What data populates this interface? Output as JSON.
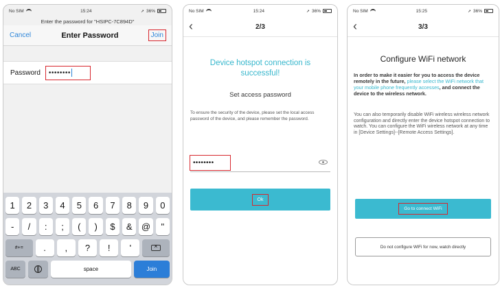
{
  "screens": [
    {
      "status": {
        "carrier": "No SIM",
        "time": "15:24",
        "battery": "36%"
      },
      "subtitle": "Enter the password for \"HSIPC-7C894D\"",
      "nav": {
        "cancel": "Cancel",
        "title": "Enter Password",
        "join": "Join"
      },
      "password_label": "Password",
      "password_value": "••••••••",
      "keyboard": {
        "row1": [
          "1",
          "2",
          "3",
          "4",
          "5",
          "6",
          "7",
          "8",
          "9",
          "0"
        ],
        "row2": [
          "-",
          "/",
          ":",
          ";",
          "(",
          ")",
          "$",
          "&",
          "@",
          "\""
        ],
        "row3_left": "#+=",
        "row3": [
          ".",
          ",",
          "?",
          "!",
          "'"
        ],
        "abc": "ABC",
        "space": "space",
        "join": "Join"
      }
    },
    {
      "status": {
        "carrier": "No SIM",
        "time": "15:24",
        "battery": "36%"
      },
      "step": "2/3",
      "success": "Device hotspot connection is successful!",
      "set_title": "Set access password",
      "desc": "To ensure the security of the device, please set the local access password of the device, and please remember the password.",
      "password_value": "••••••••",
      "ok": "Ok"
    },
    {
      "status": {
        "carrier": "No SIM",
        "time": "15:25",
        "battery": "36%"
      },
      "step": "3/3",
      "title": "Configure WiFi network",
      "para1_a": "In order to make it easier for you to access the device remotely in the future, ",
      "para1_link": "please select the WiFi network that your mobile phone frequently accesses",
      "para1_b": ",   and connect the device to the wireless network.",
      "para2": "You can also temporarily disable WiFi wireless wireless network configuration and directly enter the device hotspot connection to watch. You can configure the WiFi wireless network at any time in [Device Settings]--[Remote Access Settings].",
      "go_button": "Go to connect WiFi",
      "skip_button": "Do not configure WiFi for now, watch directly"
    }
  ]
}
